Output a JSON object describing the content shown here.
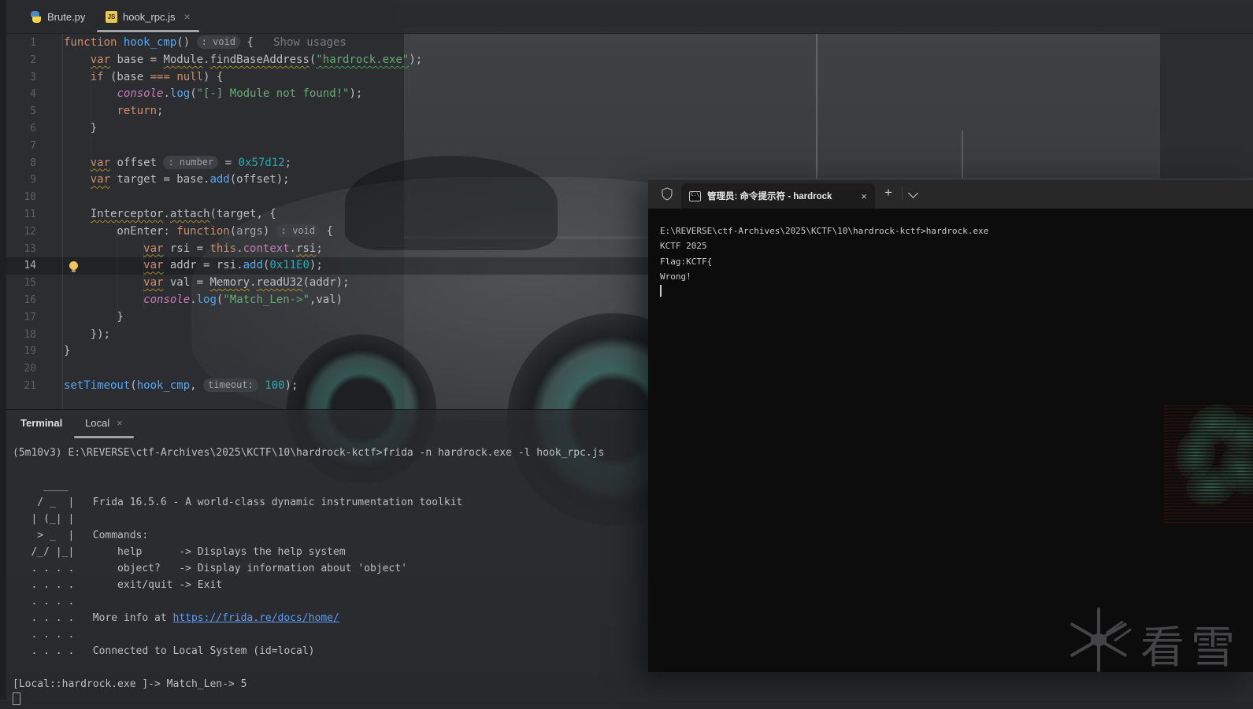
{
  "editor_tabs": {
    "tabs": [
      {
        "label": "Brute.py",
        "icon": "python-icon",
        "active": false
      },
      {
        "label": "hook_rpc.js",
        "icon": "javascript-icon",
        "active": true,
        "closable": true
      }
    ],
    "close_glyph": "×"
  },
  "editor": {
    "language": "javascript",
    "current_line": 14,
    "lines": [
      {
        "n": 1,
        "tokens": [
          {
            "t": "function ",
            "c": "kw"
          },
          {
            "t": "hook_cmp",
            "c": "fn"
          },
          {
            "t": "() "
          },
          {
            "t": ": void",
            "c": "chip"
          },
          {
            "t": " { "
          },
          {
            "t": "  Show usages",
            "c": "hint"
          }
        ]
      },
      {
        "n": 2,
        "tokens": [
          {
            "t": "    "
          },
          {
            "t": "var",
            "c": "kw",
            "u": "y"
          },
          {
            "t": " base = "
          },
          {
            "t": "Module",
            "u": "y"
          },
          {
            "t": "."
          },
          {
            "t": "findBaseAddress",
            "u": "y"
          },
          {
            "t": "("
          },
          {
            "t": "\"hardrock.exe\"",
            "c": "str",
            "u": "g"
          },
          {
            "t": ");"
          }
        ]
      },
      {
        "n": 3,
        "tokens": [
          {
            "t": "    "
          },
          {
            "t": "if",
            "c": "kw"
          },
          {
            "t": " (base "
          },
          {
            "t": "===",
            "c": "kw"
          },
          {
            "t": " "
          },
          {
            "t": "null",
            "c": "kw"
          },
          {
            "t": ") {"
          }
        ]
      },
      {
        "n": 4,
        "tokens": [
          {
            "t": "        "
          },
          {
            "t": "console",
            "c": "cls"
          },
          {
            "t": "."
          },
          {
            "t": "log",
            "c": "fn"
          },
          {
            "t": "("
          },
          {
            "t": "\"[-] Module not found!\"",
            "c": "str"
          },
          {
            "t": ");"
          }
        ]
      },
      {
        "n": 5,
        "tokens": [
          {
            "t": "        "
          },
          {
            "t": "return",
            "c": "kw"
          },
          {
            "t": ";"
          }
        ]
      },
      {
        "n": 6,
        "tokens": [
          {
            "t": "    }"
          }
        ]
      },
      {
        "n": 7,
        "tokens": []
      },
      {
        "n": 8,
        "tokens": [
          {
            "t": "    "
          },
          {
            "t": "var",
            "c": "kw",
            "u": "y"
          },
          {
            "t": " offset "
          },
          {
            "t": ": number",
            "c": "chip"
          },
          {
            "t": " = "
          },
          {
            "t": "0x57d12",
            "c": "num"
          },
          {
            "t": ";"
          }
        ]
      },
      {
        "n": 9,
        "tokens": [
          {
            "t": "    "
          },
          {
            "t": "var",
            "c": "kw",
            "u": "y"
          },
          {
            "t": " target = base."
          },
          {
            "t": "add",
            "c": "fn"
          },
          {
            "t": "(offset);"
          }
        ]
      },
      {
        "n": 10,
        "tokens": []
      },
      {
        "n": 11,
        "tokens": [
          {
            "t": "    "
          },
          {
            "t": "Interceptor",
            "u": "y"
          },
          {
            "t": "."
          },
          {
            "t": "attach",
            "u": "y"
          },
          {
            "t": "(target, {"
          }
        ]
      },
      {
        "n": 12,
        "tokens": [
          {
            "t": "        onEnter: "
          },
          {
            "t": "function",
            "c": "kw"
          },
          {
            "t": "("
          },
          {
            "t": "args",
            "c": "dim"
          },
          {
            "t": ") "
          },
          {
            "t": ": void",
            "c": "chip"
          },
          {
            "t": " {"
          }
        ]
      },
      {
        "n": 13,
        "tokens": [
          {
            "t": "            "
          },
          {
            "t": "var",
            "c": "kw",
            "u": "y"
          },
          {
            "t": " rsi = "
          },
          {
            "t": "this",
            "c": "kw"
          },
          {
            "t": "."
          },
          {
            "t": "context",
            "c": "field"
          },
          {
            "t": "."
          },
          {
            "t": "rsi",
            "u": "y"
          },
          {
            "t": ";"
          }
        ]
      },
      {
        "n": 14,
        "tokens": [
          {
            "t": "            "
          },
          {
            "t": "var",
            "c": "kw",
            "u": "y"
          },
          {
            "t": " addr = rsi."
          },
          {
            "t": "add",
            "c": "fn"
          },
          {
            "t": "("
          },
          {
            "t": "0x11E0",
            "c": "num"
          },
          {
            "t": ");"
          }
        ]
      },
      {
        "n": 15,
        "tokens": [
          {
            "t": "            "
          },
          {
            "t": "var",
            "c": "kw",
            "u": "y"
          },
          {
            "t": " val = "
          },
          {
            "t": "Memory",
            "u": "y"
          },
          {
            "t": "."
          },
          {
            "t": "readU32",
            "u": "y"
          },
          {
            "t": "(addr);"
          }
        ]
      },
      {
        "n": 16,
        "tokens": [
          {
            "t": "            "
          },
          {
            "t": "console",
            "c": "cls"
          },
          {
            "t": "."
          },
          {
            "t": "log",
            "c": "fn"
          },
          {
            "t": "("
          },
          {
            "t": "\"Match_Len->\"",
            "c": "str"
          },
          {
            "t": ",val)"
          }
        ]
      },
      {
        "n": 17,
        "tokens": [
          {
            "t": "        }"
          }
        ]
      },
      {
        "n": 18,
        "tokens": [
          {
            "t": "    });"
          }
        ]
      },
      {
        "n": 19,
        "tokens": [
          {
            "t": "}"
          }
        ]
      },
      {
        "n": 20,
        "tokens": []
      },
      {
        "n": 21,
        "tokens": [
          {
            "t": "setTimeout",
            "c": "fn"
          },
          {
            "t": "("
          },
          {
            "t": "hook_cmp",
            "c": "fn"
          },
          {
            "t": ", "
          },
          {
            "t": "timeout:",
            "c": "chip"
          },
          {
            "t": " "
          },
          {
            "t": "100",
            "c": "num"
          },
          {
            "t": ");"
          }
        ]
      }
    ]
  },
  "terminal_panel": {
    "title": "Terminal",
    "tab_label": "Local",
    "close_glyph": "×",
    "lines": [
      [
        {
          "t": "(5m10v3) E:\\REVERSE\\ctf-Archives\\2025\\KCTF\\10\\hardrock-kctf>frida -n hardrock.exe -l hook_rpc.js"
        }
      ],
      [
        {
          "t": ""
        }
      ],
      [
        {
          "t": "     ____"
        }
      ],
      [
        {
          "t": "    / _  |   Frida 16.5.6 - A world-class dynamic instrumentation toolkit"
        }
      ],
      [
        {
          "t": "   | (_| |"
        }
      ],
      [
        {
          "t": "    > _  |   Commands:"
        }
      ],
      [
        {
          "t": "   /_/ |_|       help      -> Displays the help system"
        }
      ],
      [
        {
          "t": "   . . . .       object?   -> Display information about 'object'"
        }
      ],
      [
        {
          "t": "   . . . .       exit/quit -> Exit"
        }
      ],
      [
        {
          "t": "   . . . ."
        }
      ],
      [
        {
          "t": "   . . . .   More info at "
        },
        {
          "t": "https://frida.re/docs/home/",
          "c": "link"
        }
      ],
      [
        {
          "t": "   . . . ."
        }
      ],
      [
        {
          "t": "   . . . .   Connected to Local System (id=local)"
        }
      ],
      [
        {
          "t": ""
        }
      ],
      [
        {
          "t": "[Local::hardrock.exe ]-> Match_Len-> 5"
        }
      ],
      [
        {
          "t": "",
          "c": "cursor"
        }
      ]
    ]
  },
  "cmd_window": {
    "title": "管理员: 命令提示符 - hardrock",
    "close_glyph": "×",
    "new_tab_glyph": "+",
    "icon_label": "C:\\_",
    "lines": [
      "E:\\REVERSE\\ctf-Archives\\2025\\KCTF\\10\\hardrock-kctf>hardrock.exe",
      "KCTF 2025",
      "Flag:KCTF{",
      "Wrong!"
    ]
  },
  "watermarks": {
    "kanxue_text": "看雪"
  },
  "colors": {
    "editor_bg": "#2B2D30",
    "keyword": "#CF8E6D",
    "function": "#57A8F5",
    "string": "#6AAB73",
    "number": "#2AACB8",
    "console_global": "#C77DBB",
    "default_text": "#BCBEC4",
    "inlay_chip_bg": "#3D4045",
    "link": "#5E9BF5",
    "cmd_bg": "#0C0C0C",
    "cmd_text": "#CCCCCC",
    "wheel_accent": "#2DBEA0"
  }
}
